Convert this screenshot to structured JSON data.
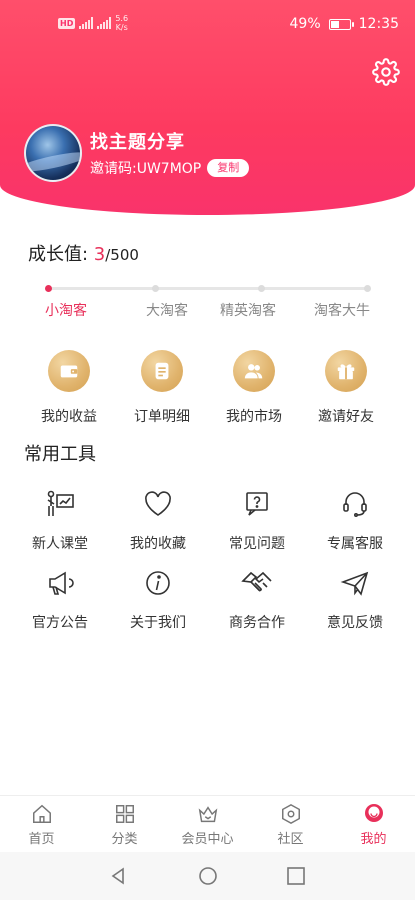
{
  "status_bar": {
    "hd": "HD",
    "net_speed_value": "5.6",
    "net_speed_unit": "K/s",
    "battery_percent": "49%",
    "battery_level": 0.49,
    "time": "12:35"
  },
  "profile": {
    "username": "找主题分享",
    "invite_code": "邀请码:UW7MOP",
    "copy_label": "复制"
  },
  "growth": {
    "label": "成长值: ",
    "current": "3",
    "total": "/500",
    "levels": [
      "小淘客",
      "大淘客",
      "精英淘客",
      "淘客大牛"
    ],
    "active_level": 0
  },
  "quick_actions": [
    {
      "label": "我的收益",
      "icon": "wallet-icon"
    },
    {
      "label": "订单明细",
      "icon": "order-list-icon"
    },
    {
      "label": "我的市场",
      "icon": "team-icon"
    },
    {
      "label": "邀请好友",
      "icon": "gift-icon"
    }
  ],
  "tools_section": {
    "title": "常用工具",
    "items": [
      {
        "label": "新人课堂",
        "icon": "teacher-icon"
      },
      {
        "label": "我的收藏",
        "icon": "heart-icon"
      },
      {
        "label": "常见问题",
        "icon": "question-icon"
      },
      {
        "label": "专属客服",
        "icon": "headset-icon"
      },
      {
        "label": "官方公告",
        "icon": "megaphone-icon"
      },
      {
        "label": "关于我们",
        "icon": "info-icon"
      },
      {
        "label": "商务合作",
        "icon": "handshake-icon"
      },
      {
        "label": "意见反馈",
        "icon": "paper-plane-icon"
      }
    ]
  },
  "tabbar": {
    "tabs": [
      {
        "label": "首页",
        "icon": "home-icon"
      },
      {
        "label": "分类",
        "icon": "grid-icon"
      },
      {
        "label": "会员中心",
        "icon": "crown-icon"
      },
      {
        "label": "社区",
        "icon": "hexagon-icon"
      },
      {
        "label": "我的",
        "icon": "profile-icon"
      }
    ],
    "active_index": 4
  },
  "colors": {
    "accent": "#e8305a",
    "header": "#fd3a60",
    "gold": "#e0b36c"
  }
}
